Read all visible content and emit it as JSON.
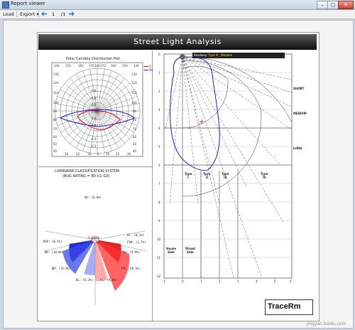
{
  "window": {
    "title": "Report viewer",
    "minimize": "–",
    "maximize": "□",
    "close": "✕"
  },
  "toolbar": {
    "load_label": "Load",
    "export_label": "Export",
    "export_arrow": "▾",
    "current_page": "1",
    "page_total": "/1"
  },
  "report": {
    "title": "Street  Light  Analysis",
    "polar": {
      "title": "Polar Candela Distribution Plot",
      "legend": [
        "0",
        "90"
      ],
      "tick_values": [
        "0.9",
        "0.8",
        "0.6",
        "0.5",
        "0.4",
        "0.3",
        "0.2",
        "0.1"
      ],
      "angle_labels_top": [
        "140",
        "150",
        "160",
        "170",
        "180",
        "170",
        "160",
        "150",
        "140"
      ],
      "angle_labels_left": [
        "130",
        "120",
        "110",
        "100",
        "90",
        "80",
        "70",
        "60",
        "50",
        "40"
      ],
      "angle_labels_bottom": [
        "30",
        "20",
        "10",
        "0",
        "10",
        "20",
        "30"
      ],
      "colors": {
        "c0": "#e0001a",
        "c90": "#1a1ad0"
      }
    },
    "bug": {
      "heading": "LUMINAIRE CLASSIFICATION SYSTEM",
      "rating": "(BUG RATING = B0-U1-G0)",
      "uh": "UH: (0.0%)",
      "ul": "UL: (0.1%)",
      "bvh": "BVH: (0.5%)",
      "fvh": "FVH: (1.7%)",
      "bh": "BH: (10.0%)",
      "fh": "FH: (9.9%)",
      "bm": "BM: (15.9%)",
      "fm": "FM: (20.3%)",
      "bl": "BL: (6.2%)",
      "fl": "FL: (8.0%)",
      "trapped": "Trapped",
      "trapped_pct": "(0.2%)",
      "colors": {
        "back": "#1212d8",
        "front": "#e01010"
      }
    },
    "iso": {
      "roadway_prefix": "Roadway: ",
      "roadway_type": "Type III , Medium",
      "short": "SHORT",
      "medium": "MEDIUM",
      "long": "LONG",
      "type_i": [
        "Type",
        "I"
      ],
      "type_ii": [
        "Type",
        "II"
      ],
      "type_iii": [
        "Type",
        "III"
      ],
      "type_iv": [
        "Type",
        "IV"
      ],
      "house": [
        "House",
        "Side"
      ],
      "street": [
        "Street",
        "Side"
      ],
      "y_ticks": [
        "0",
        "1",
        "2",
        "3",
        "4",
        "5",
        "6",
        "7",
        "8",
        "9",
        "10",
        "11",
        "12"
      ],
      "x_ticks": [
        "-1",
        "0",
        "1",
        "2",
        "3",
        "4",
        "5",
        "6"
      ]
    },
    "logo": "TraceRm",
    "watermark": "jingyan.baidu.com"
  }
}
